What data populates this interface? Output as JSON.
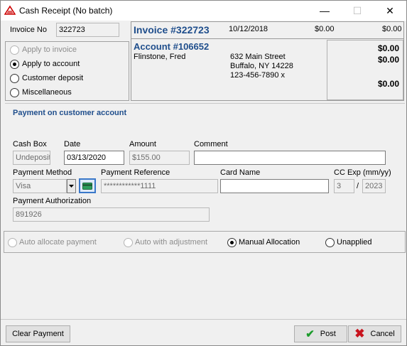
{
  "window": {
    "title": "Cash Receipt (No batch)",
    "minimize": "—",
    "maximize": "☐",
    "close": "✕"
  },
  "invoice": {
    "label": "Invoice No",
    "value": "322723",
    "header": "Invoice #322723",
    "date": "10/12/2018",
    "amount1": "$0.00",
    "amount2": "$0.00"
  },
  "apply_options": {
    "apply_invoice": "Apply to invoice",
    "apply_account": "Apply to account",
    "customer_deposit": "Customer deposit",
    "miscellaneous": "Miscellaneous",
    "selected": "apply_account"
  },
  "account": {
    "header": "Account #106652",
    "name": "Flinstone, Fred",
    "address1": "632 Main Street",
    "address2": "Buffalo, NY  14228",
    "phone": "123-456-7890 x",
    "bal1": "$0.00",
    "bal2": "$0.00",
    "bal3": "$0.00"
  },
  "payment": {
    "section_title": "Payment on customer account",
    "cash_box_label": "Cash Box",
    "cash_box": "Undeposit",
    "date_label": "Date",
    "date": "03/13/2020",
    "amount_label": "Amount",
    "amount": "$155.00",
    "comment_label": "Comment",
    "comment": "",
    "method_label": "Payment Method",
    "method": "Visa",
    "reference_label": "Payment Reference",
    "reference": "************1111",
    "card_name_label": "Card Name",
    "card_name": "",
    "cc_exp_label": "CC Exp (mm/yy)",
    "cc_month": "3",
    "cc_sep": "/",
    "cc_year": "2023",
    "auth_label": "Payment Authorization",
    "auth": "891926"
  },
  "allocation": {
    "auto": "Auto allocate payment",
    "auto_adj": "Auto with adjustment",
    "manual": "Manual Allocation",
    "unapplied": "Unapplied",
    "selected": "manual"
  },
  "footer": {
    "clear": "Clear Payment",
    "post": "Post",
    "cancel": "Cancel"
  }
}
